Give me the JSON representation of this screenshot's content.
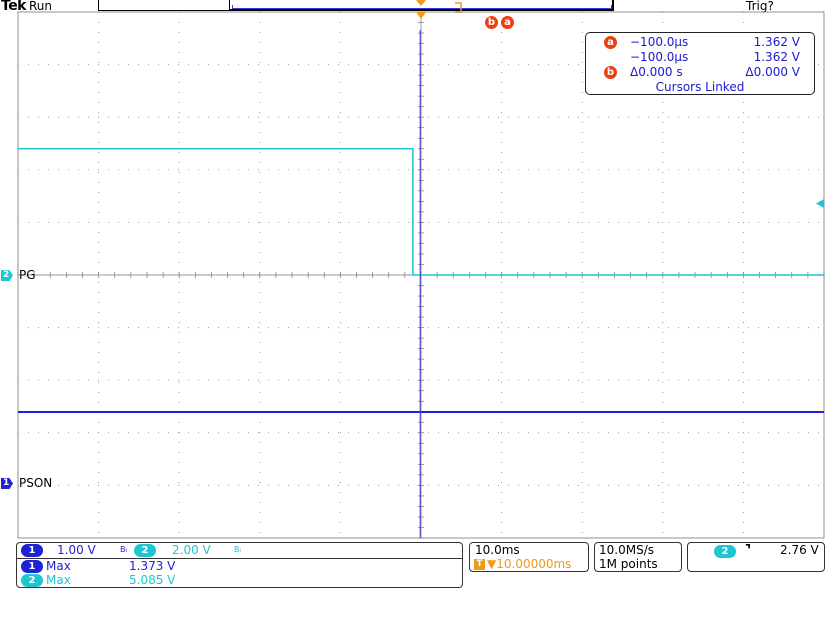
{
  "header": {
    "brand": "Tek",
    "state": "Run",
    "trigger_status": "Trig?"
  },
  "colors": {
    "ch1": "#1e22d8",
    "ch2": "#1cc7d2",
    "cursor": "#3a3ae0",
    "trigger_marker": "#f19a1a",
    "cursor_badge": "#ee3f11"
  },
  "cursor_markers": {
    "b": "b",
    "a": "a"
  },
  "cursor_readout": {
    "a_label": "a",
    "a_time": "−100.0μs",
    "a_volt": "1.362 V",
    "b_time": "−100.0μs",
    "b_volt": "1.362 V",
    "delta_label": "b",
    "delta_time": "Δ0.000 s",
    "delta_volt": "Δ0.000 V",
    "linked": "Cursors Linked"
  },
  "channels": {
    "ch1": {
      "number": "1",
      "label": "PSON",
      "scale": "1.00 V",
      "bw": "Bₗ",
      "max_label": "Max",
      "max_value": "1.373 V"
    },
    "ch2": {
      "number": "2",
      "label": "PG",
      "scale": "2.00 V",
      "bw": "Bₗ",
      "max_label": "Max",
      "max_value": "5.085 V"
    }
  },
  "timebase": {
    "scale": "10.0ms",
    "delay_icon": "T",
    "delay_value": "▼10.00000ms"
  },
  "acquisition": {
    "rate": "10.0MS/s",
    "record": "1M points"
  },
  "trigger": {
    "channel": "2",
    "slope": "⌝",
    "level": "2.76 V"
  },
  "chart_data": {
    "type": "line",
    "title": "",
    "xlabel": "",
    "ylabel": "",
    "grid": true,
    "series": [
      {
        "name": "PG",
        "x": [
          -50,
          -1.0,
          -1.0,
          50
        ],
        "y": [
          4.8,
          4.8,
          0.0,
          0.0
        ]
      },
      {
        "name": "PSON",
        "x": [
          -50,
          50
        ],
        "y": [
          1.35,
          1.35
        ]
      }
    ]
  }
}
